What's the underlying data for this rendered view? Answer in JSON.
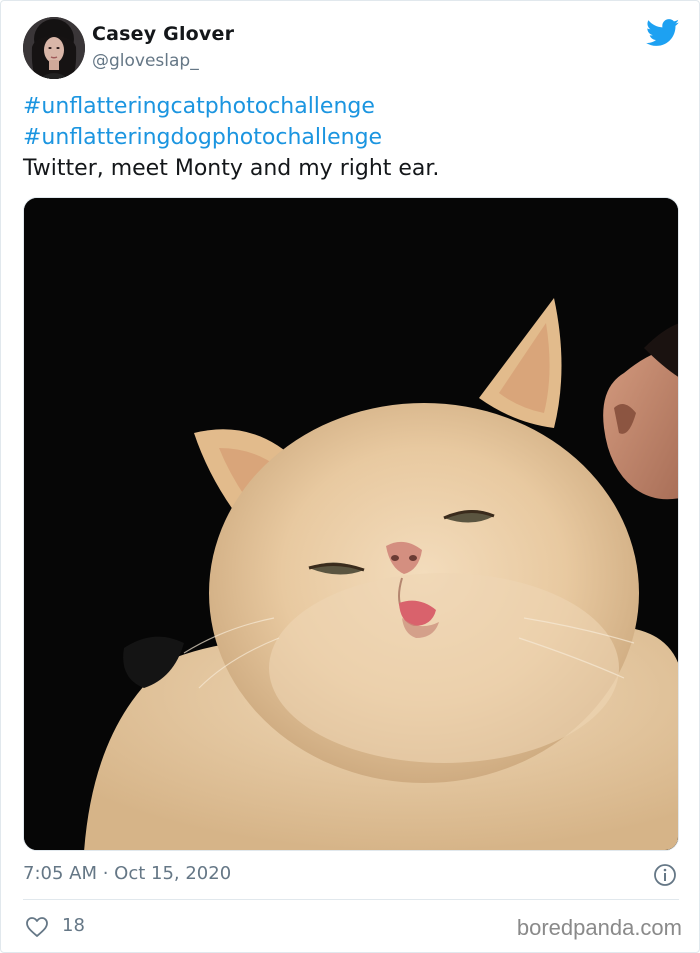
{
  "author": {
    "display_name": "Casey Glover",
    "handle": "@gloveslap_",
    "avatar_icon": "user-avatar-photo"
  },
  "brand": {
    "logo_icon": "twitter-bird-icon",
    "color": "#1da1f2"
  },
  "tweet": {
    "hashtags": [
      "#unflatteringcatphotochallenge",
      "#unflatteringdogphotochallenge"
    ],
    "text": "Twitter, meet Monty and my right ear.",
    "hashtag_color": "#1b95e0"
  },
  "media": {
    "icon": "cat-photo"
  },
  "meta": {
    "timestamp": "7:05 AM · Oct 15, 2020",
    "info_icon": "info-icon"
  },
  "actions": {
    "like_icon": "heart-icon",
    "like_count": "18"
  },
  "watermark": {
    "text": "boredpanda.com"
  }
}
